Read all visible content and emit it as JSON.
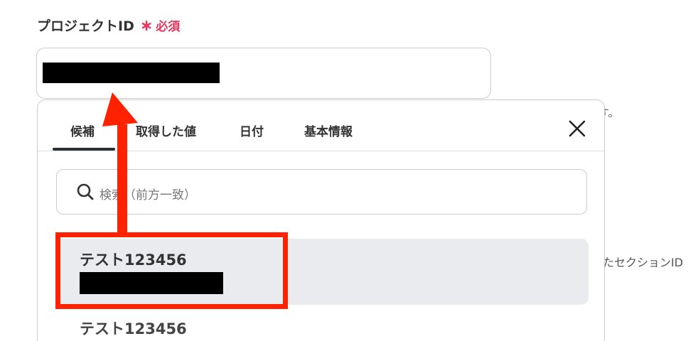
{
  "field": {
    "label": "プロジェクトID",
    "required_star": "∗",
    "required_text": "必須"
  },
  "background_hints": {
    "hint1": "す。",
    "hint2": "たセクションID"
  },
  "popup": {
    "tabs": [
      {
        "label": "候補",
        "active": true
      },
      {
        "label": "取得した値",
        "active": false
      },
      {
        "label": "日付",
        "active": false
      },
      {
        "label": "基本情報",
        "active": false
      }
    ],
    "close_icon": "close-icon",
    "search": {
      "placeholder": "検索（前方一致）",
      "icon": "search-icon"
    },
    "options": [
      {
        "title": "テスト123456",
        "selected": true
      },
      {
        "title": "テスト123456",
        "selected": false
      }
    ]
  },
  "annotation": {
    "color": "#ff2200"
  }
}
